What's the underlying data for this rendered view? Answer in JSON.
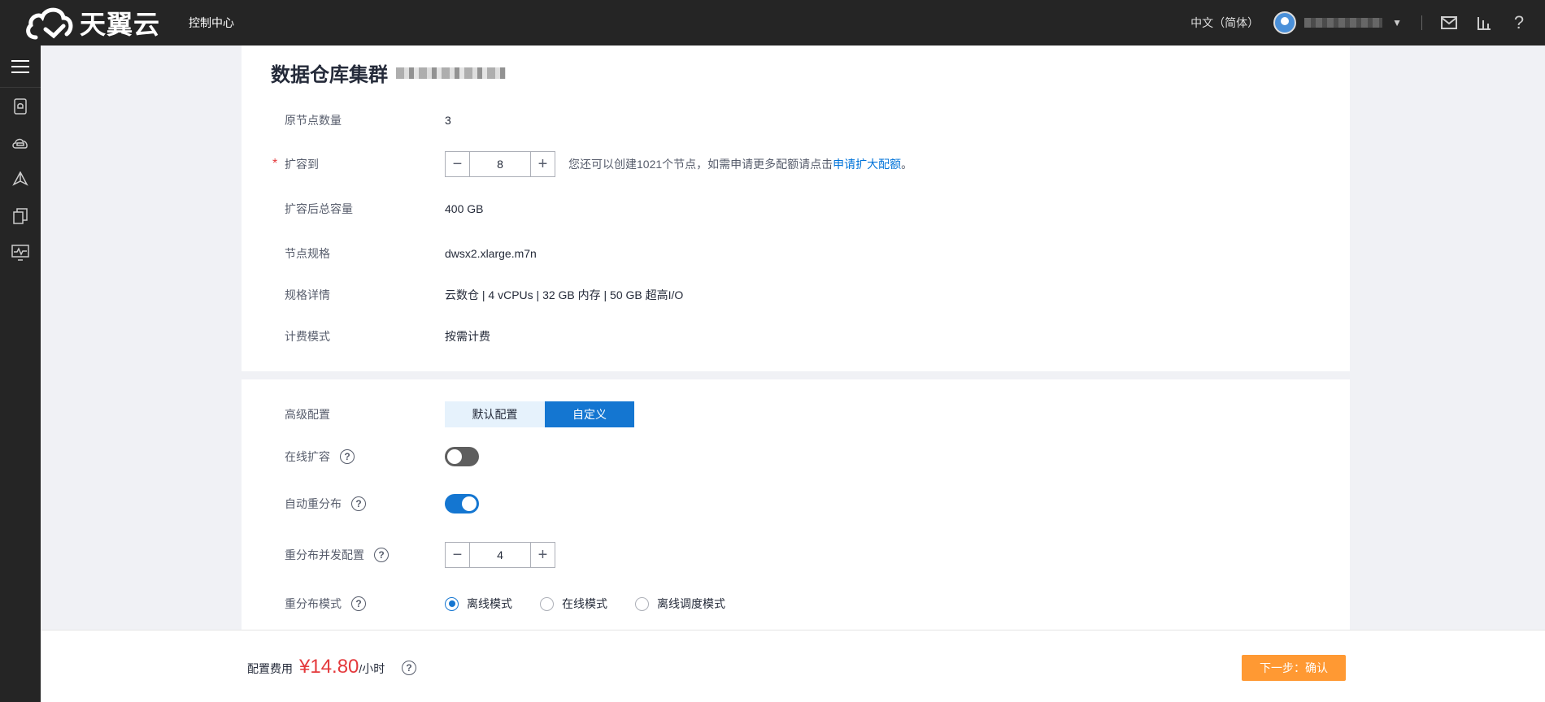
{
  "header": {
    "logo_text": "天翼云",
    "console_link": "控制中心",
    "language": "中文（简体）",
    "icons": [
      "mail-icon",
      "bar-chart-icon",
      "help-icon"
    ]
  },
  "sidebar": {
    "icons": [
      "menu-icon",
      "database-icon",
      "cloud-icon",
      "network-icon",
      "copy-icon",
      "monitor-icon"
    ]
  },
  "main": {
    "title": "数据仓库集群",
    "rows": {
      "original_nodes": {
        "label": "原节点数量",
        "value": "3"
      },
      "scale_to": {
        "label": "扩容到",
        "required_mark": "*",
        "value": "8",
        "hint_prefix": "您还可以创建1021个节点，如需申请更多配额请点击",
        "hint_link": "申请扩大配额",
        "hint_suffix": "。"
      },
      "total_capacity": {
        "label": "扩容后总容量",
        "value": "400 GB"
      },
      "node_flavor": {
        "label": "节点规格",
        "value": "dwsx2.xlarge.m7n"
      },
      "flavor_detail": {
        "label": "规格详情",
        "value": "云数仓 | 4 vCPUs | 32 GB 内存 | 50 GB 超高I/O"
      },
      "billing_mode": {
        "label": "计费模式",
        "value": "按需计费"
      }
    }
  },
  "advanced": {
    "label": "高级配置",
    "options": [
      "默认配置",
      "自定义"
    ],
    "selected": "自定义",
    "online_scale": {
      "label": "在线扩容",
      "enabled": false
    },
    "auto_redistribute": {
      "label": "自动重分布",
      "enabled": true
    },
    "redistribute_concurrency": {
      "label": "重分布并发配置",
      "value": "4"
    },
    "redistribute_mode": {
      "label": "重分布模式",
      "options": [
        "离线模式",
        "在线模式",
        "离线调度模式"
      ],
      "selected": "离线模式"
    }
  },
  "footer": {
    "fee_label": "配置费用",
    "price": "¥14.80",
    "unit": "/小时",
    "next_button": "下一步：确认"
  },
  "colors": {
    "accent": "#1476d1",
    "price": "#e4393c",
    "next_button": "#ff9933",
    "topbar": "#252525"
  }
}
